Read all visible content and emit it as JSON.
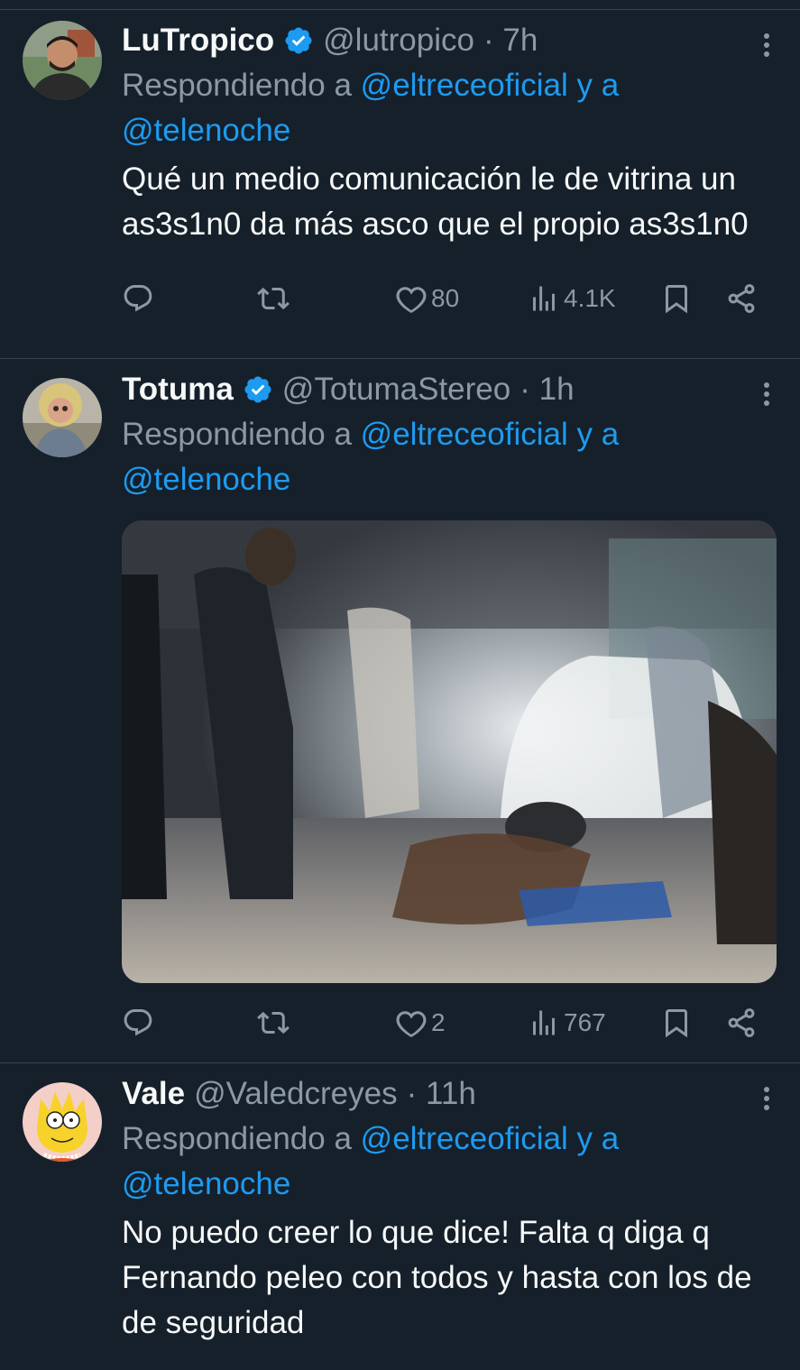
{
  "tweets": [
    {
      "name": "LuTropico",
      "handle": "@lutropico",
      "time": "· 7h",
      "replying_prefix": "Respondiendo a",
      "reply_to_1": "@eltreceoficial",
      "reply_join": "y a",
      "reply_to_2": "@telenoche",
      "text": "Qué un medio comunicación le de vitrina un as3s1n0 da más asco que el propio as3s1n0",
      "likes": "80",
      "views": "4.1K",
      "avatar_colors": {
        "bg": "#7d8c7a",
        "face": "#c48e6d",
        "shirt": "#2b2b2b"
      }
    },
    {
      "name": "Totuma",
      "handle": "@TotumaStereo",
      "time": "· 1h",
      "replying_prefix": "Respondiendo a",
      "reply_to_1": "@eltreceoficial",
      "reply_join": "y a",
      "reply_to_2": "@telenoche",
      "likes": "2",
      "views": "767",
      "avatar_colors": {
        "bg": "#b8b4a8",
        "face": "#d9a48a",
        "hair": "#d8c47a"
      }
    },
    {
      "name": "Vale",
      "handle": "@Valedcreyes",
      "time": "· 11h",
      "replying_prefix": "Respondiendo a",
      "reply_to_1": "@eltreceoficial",
      "reply_join": "y a",
      "reply_to_2": "@telenoche",
      "text": "No puedo creer lo que dice! Falta q diga q Fernando peleo con todos y hasta con los de de seguridad",
      "avatar_colors": {
        "bg": "#f4cfc7",
        "face": "#f6d22a"
      }
    }
  ],
  "icons": [
    "reply-icon",
    "retweet-icon",
    "like-icon",
    "views-icon",
    "bookmark-icon",
    "share-icon",
    "verified-badge-icon",
    "more-icon"
  ],
  "colors": {
    "background": "#15202b",
    "accent": "#1d9bf0",
    "muted": "#8b98a5",
    "divider": "#38444d"
  }
}
